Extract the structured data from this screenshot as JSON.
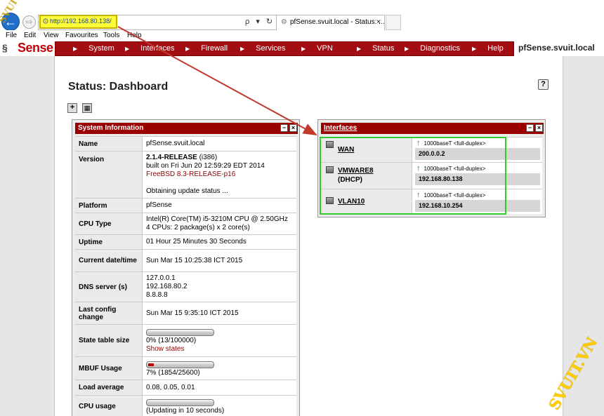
{
  "browser": {
    "url": "http://192.168.80.138/",
    "tab_title": "pfSense.svuit.local - Status: ...",
    "tab_close": "×",
    "back_glyph": "←",
    "forward_glyph": "⇨",
    "address_icons": "ρ ▾ ↻",
    "menu": [
      "File",
      "Edit",
      "View",
      "Favourites",
      "Tools",
      "Help"
    ]
  },
  "nav": {
    "logo_pf": "§",
    "logo_text": "Sense",
    "items": [
      "System",
      "Interfaces",
      "Firewall",
      "Services",
      "VPN",
      "Status",
      "Diagnostics",
      "Help"
    ],
    "hostname": "pfSense.svuit.local"
  },
  "page": {
    "title": "Status: Dashboard",
    "help_glyph": "?",
    "add_glyph": "+"
  },
  "system_info": {
    "title": "System Information",
    "min_glyph": "−",
    "close_glyph": "×",
    "rows": {
      "name": {
        "label": "Name",
        "value": "pfSense.svuit.local"
      },
      "version": {
        "label": "Version",
        "line1_bold": "2.1.4-RELEASE",
        "line1_rest": " (i386)",
        "line2": "built on Fri Jun 20 12:59:29 EDT 2014",
        "line3": "FreeBSD 8.3-RELEASE-p16",
        "line4": "Obtaining update status ..."
      },
      "platform": {
        "label": "Platform",
        "value": "pfSense"
      },
      "cpu_type": {
        "label": "CPU Type",
        "line1": "Intel(R) Core(TM) i5-3210M CPU @ 2.50GHz",
        "line2": "4 CPUs: 2 package(s) x 2 core(s)"
      },
      "uptime": {
        "label": "Uptime",
        "value": "01 Hour 25 Minutes 30 Seconds"
      },
      "datetime": {
        "label": "Current date/time",
        "value": "Sun Mar 15 10:25:38 ICT 2015"
      },
      "dns": {
        "label": "DNS server (s)",
        "line1": "127.0.0.1",
        "line2": "192.168.80.2",
        "line3": "8.8.8.8"
      },
      "last_config": {
        "label": "Last config change",
        "value": "Sun Mar 15 9:35:10 ICT 2015"
      },
      "state_table": {
        "label": "State table size",
        "value": "0% (13/100000)",
        "link": "Show states",
        "fraction": 0.0
      },
      "mbuf": {
        "label": "MBUF Usage",
        "value": "7% (1854/25600)",
        "fraction": 0.07
      },
      "load": {
        "label": "Load average",
        "value": "0.08, 0.05, 0.01"
      },
      "cpu_usage": {
        "label": "CPU usage",
        "value": "(Updating in 10 seconds)",
        "fraction": 0.0
      }
    }
  },
  "interfaces": {
    "title": "Interfaces",
    "min_glyph": "−",
    "close_glyph": "×",
    "up_glyph": "↑",
    "items": [
      {
        "name_line1": "WAN",
        "name_line2": "",
        "media": "1000baseT <full-duplex>",
        "ip": "200.0.0.2"
      },
      {
        "name_line1": "VMWARE8",
        "name_line2": "(DHCP)",
        "media": "1000baseT <full-duplex>",
        "ip": "192.168.80.138"
      },
      {
        "name_line1": "VLAN10",
        "name_line2": "",
        "media": "1000baseT <full-duplex>",
        "ip": "192.168.10.254"
      }
    ]
  },
  "watermarks": {
    "top_left": "SVUIT.COM",
    "bottom_right": "SVUIT.VN"
  },
  "colors": {
    "nav_red": "#a30e13",
    "widget_header": "#990000",
    "highlight_yellow": "#ffff3a",
    "annotation_green": "#2ecc2e",
    "arrow_red": "#c0392b"
  }
}
